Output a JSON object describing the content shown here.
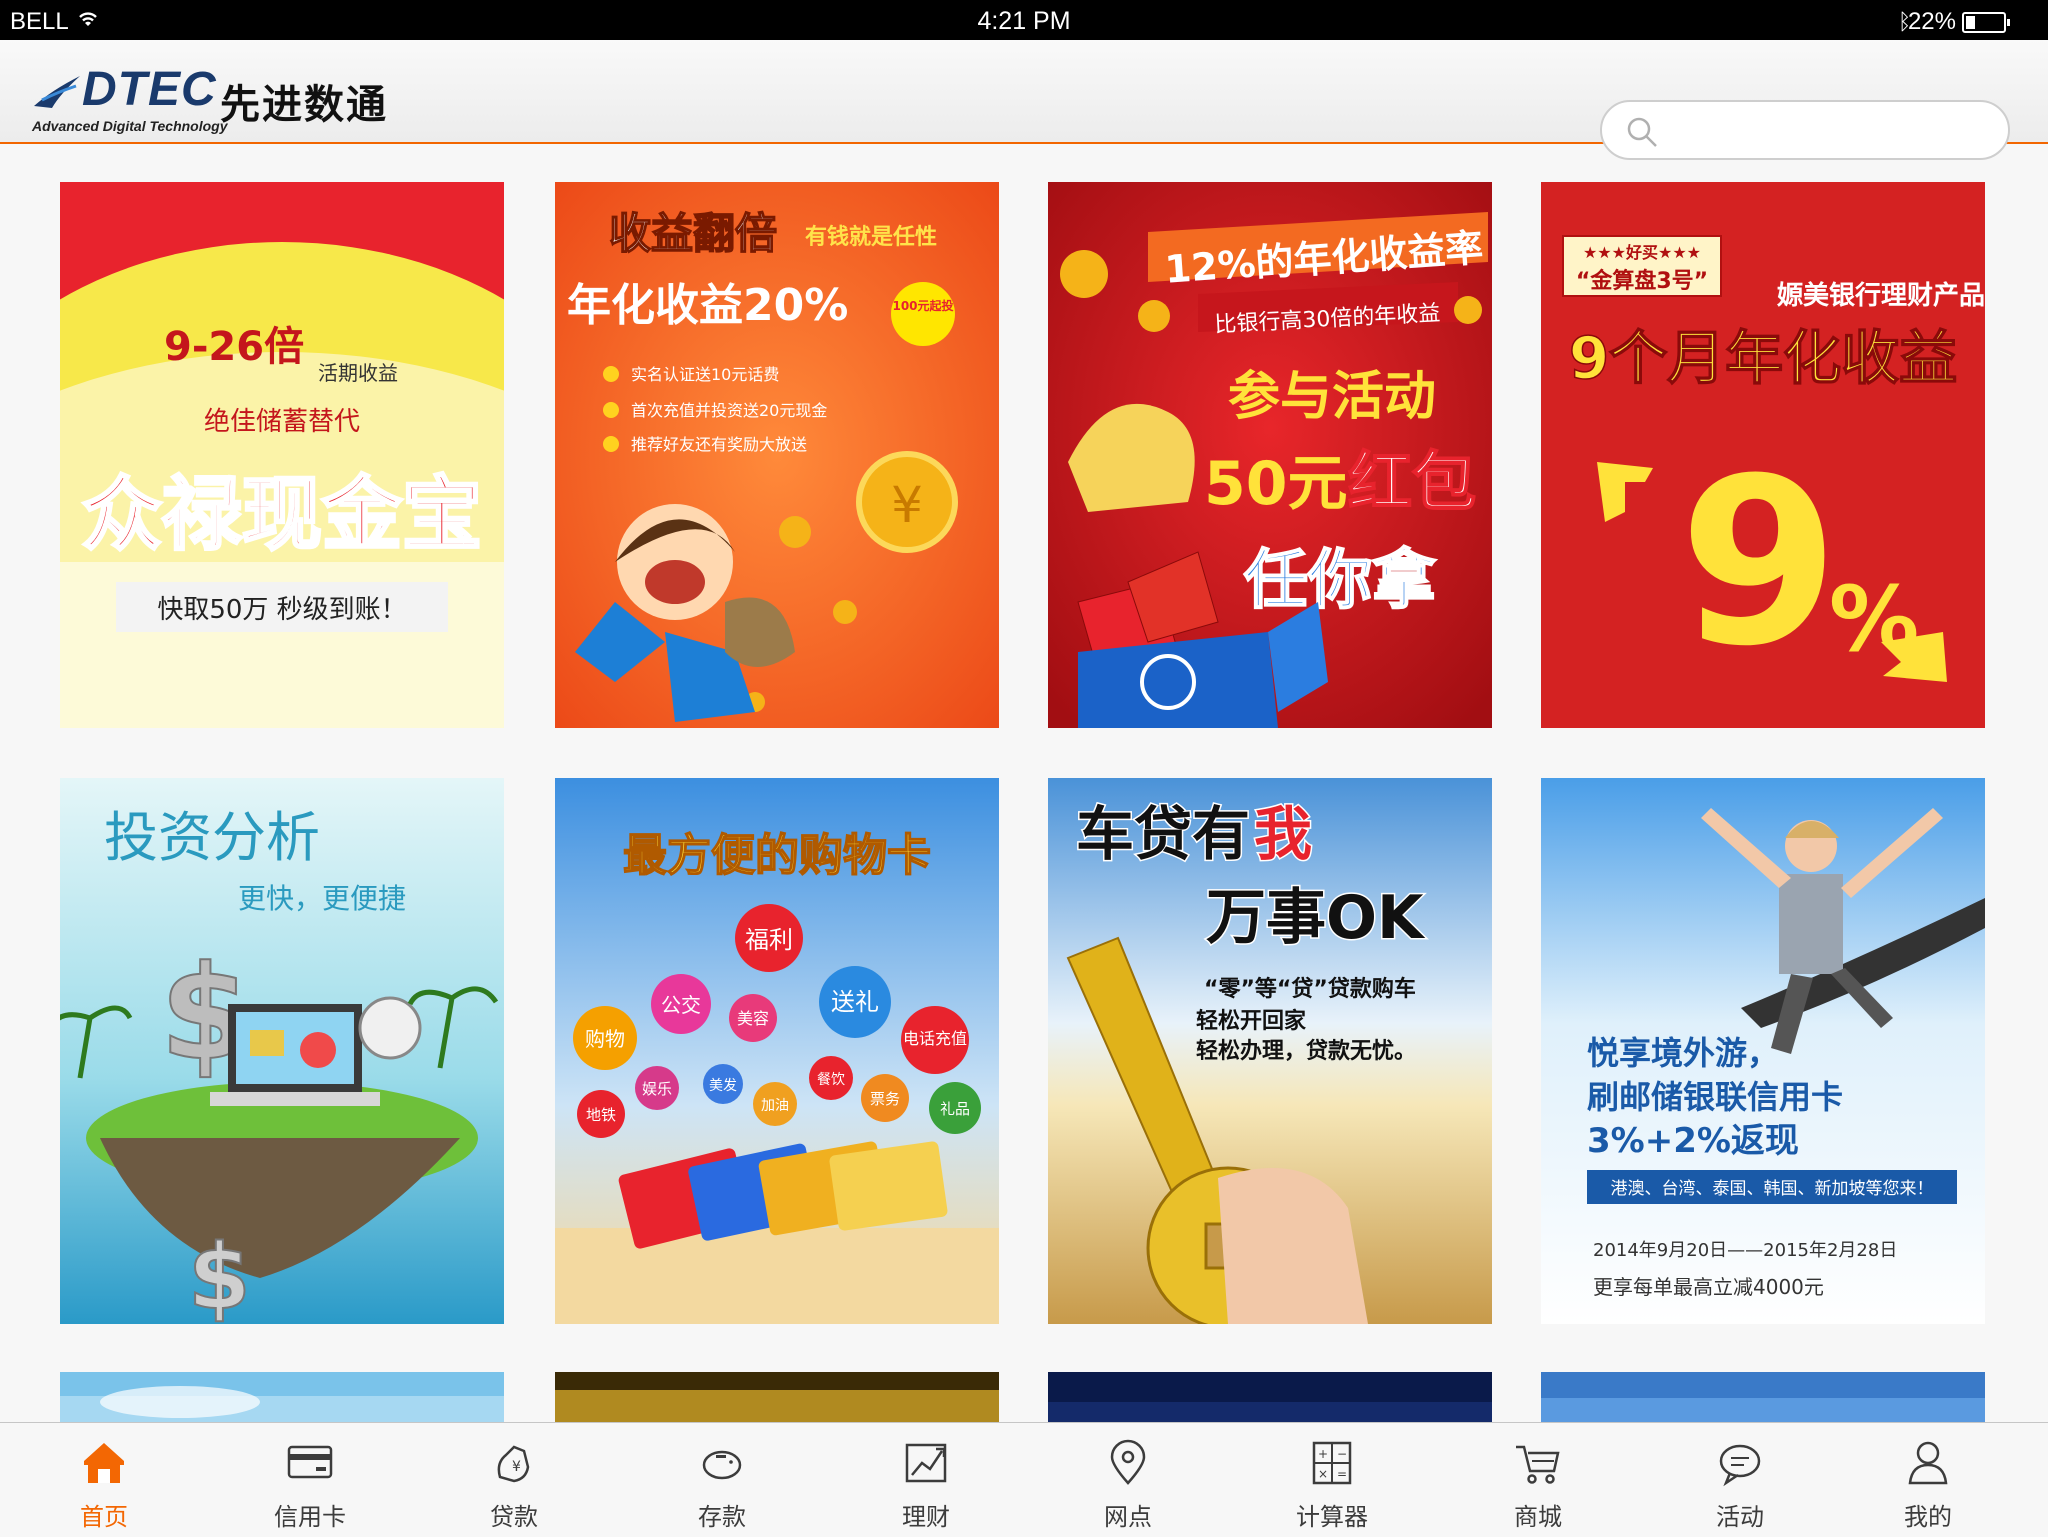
{
  "status_bar": {
    "carrier": "BELL",
    "time": "4:21 PM",
    "battery": "22%"
  },
  "header": {
    "logo_brand": "DTEC",
    "logo_cn": "先进数通",
    "logo_sub": "Advanced Digital Technology",
    "search_value": "",
    "colors": {
      "accent": "#F26600",
      "search_border": "#CECECE",
      "search_bg": "#FFFFFF"
    }
  },
  "cards": [
    {
      "id": "zhonglu",
      "headline": "9-26倍",
      "sub1": "活期收益",
      "sub2": "绝佳储蓄替代",
      "title": "众禄现金宝",
      "tagline": "快取50万 秒级到账！"
    },
    {
      "id": "shouyi",
      "headline": "收益翻倍",
      "headline_tag": "有钱就是任性",
      "title": "年化收益20%",
      "badge": "100元起投",
      "bullets": [
        "实名认证送10元话费",
        "首次充值并投资送20元现金",
        "推荐好友还有奖励大放送"
      ]
    },
    {
      "id": "hongbao",
      "banner1": "12%的年化收益率",
      "banner2": "比银行高30倍的年收益",
      "line1": "参与活动",
      "line2": "50元",
      "line2b": "红包",
      "line3": "任你拿"
    },
    {
      "id": "jinsuanpan",
      "stars": "★★★好买★★★",
      "label": "“金算盘3号”",
      "brand": "嫄美银行理财产品",
      "title": "9个月年化收益",
      "big": "9",
      "pct": "%"
    },
    {
      "id": "touzi",
      "title": "投资分析",
      "subtitle": "更快，更便捷"
    },
    {
      "id": "gouwuka",
      "title": "最方便的购物卡",
      "bubbles": [
        "福利",
        "公交",
        "美容",
        "送礼",
        "购物",
        "电话充值",
        "娱乐",
        "美发",
        "加油",
        "餐饮",
        "票务",
        "地铁",
        "礼品"
      ]
    },
    {
      "id": "chedai",
      "title1": "车贷有",
      "title1b": "我",
      "title2": "万事OK",
      "lines": [
        "“零”等“贷”贷款购车",
        "轻松开回家",
        "轻松办理，贷款无忧。"
      ]
    },
    {
      "id": "jingwai",
      "title": "悦享境外游，",
      "line2": "刷邮储银联信用卡",
      "line3": "3%+2%返现",
      "bar": "港澳、台湾、泰国、韩国、新加坡等您来！",
      "date": "2014年9月20日——2015年2月28日",
      "note": "更享每单最高立减4000元"
    }
  ],
  "tabs": [
    {
      "label": "首页",
      "icon": "home-icon",
      "active": true
    },
    {
      "label": "信用卡",
      "icon": "credit-card-icon",
      "active": false
    },
    {
      "label": "贷款",
      "icon": "loan-icon",
      "active": false
    },
    {
      "label": "存款",
      "icon": "piggy-bank-icon",
      "active": false
    },
    {
      "label": "理财",
      "icon": "chart-icon",
      "active": false
    },
    {
      "label": "网点",
      "icon": "location-pin-icon",
      "active": false
    },
    {
      "label": "计算器",
      "icon": "calculator-icon",
      "active": false
    },
    {
      "label": "商城",
      "icon": "cart-icon",
      "active": false
    },
    {
      "label": "活动",
      "icon": "chat-bubble-icon",
      "active": false
    },
    {
      "label": "我的",
      "icon": "user-icon",
      "active": false
    }
  ],
  "colors": {
    "tab_active": "#F36703",
    "tab_inactive": "#3C3C3C",
    "tab_border": "#C6C6C6"
  }
}
